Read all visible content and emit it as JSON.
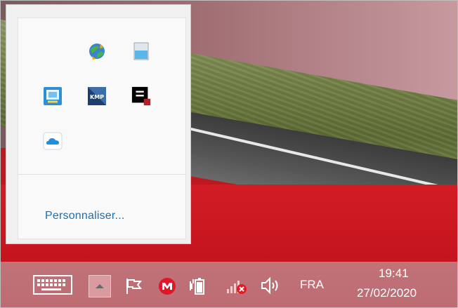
{
  "overflow_popup": {
    "customize_label": "Personnaliser...",
    "icons": [
      "network-globe-icon",
      "window-app-icon",
      "windows-recovery-icon",
      "kmplayer-icon",
      "black-app-icon",
      "onedrive-icon"
    ]
  },
  "taskbar": {
    "language": "FRA",
    "clock_time": "19:41",
    "clock_date": "27/02/2020",
    "kmp_label": "KMP"
  },
  "colors": {
    "taskbar": "#bd6c72",
    "link": "#1f6fb0",
    "wallpaper_red": "#c6141c"
  }
}
